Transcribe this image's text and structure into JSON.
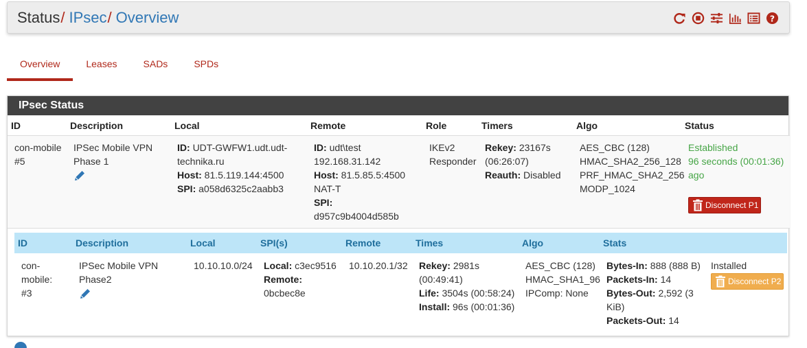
{
  "breadcrumb": {
    "root": "Status",
    "link1": "IPsec",
    "link2": "Overview",
    "sep": "/"
  },
  "header_icons": [
    "refresh-icon",
    "stop-icon",
    "sliders-icon",
    "bar-chart-icon",
    "log-icon",
    "help-icon"
  ],
  "tabs": [
    {
      "label": "Overview",
      "active": true
    },
    {
      "label": "Leases",
      "active": false
    },
    {
      "label": "SADs",
      "active": false
    },
    {
      "label": "SPDs",
      "active": false
    }
  ],
  "panel": {
    "title": "IPsec Status",
    "columns": [
      "ID",
      "Description",
      "Local",
      "Remote",
      "Role",
      "Timers",
      "Algo",
      "Status"
    ],
    "p1": {
      "id": "con-mobile #5",
      "description": "IPSec Mobile VPN Phase 1",
      "local": {
        "id_label": "ID:",
        "id_value": "UDT-GWFW1.udt.udt-technika.ru",
        "host_label": "Host:",
        "host_value": "81.5.119.144:4500",
        "spi_label": "SPI:",
        "spi_value": "a058d6325c2aabb3"
      },
      "remote": {
        "id_label": "ID:",
        "id_value": "udt\\test",
        "ip": "192.168.31.142",
        "host_label": "Host:",
        "host_value": "81.5.85.5:4500",
        "natt": "NAT-T",
        "spi_label": "SPI:",
        "spi_value": "d957c9b4004d585b"
      },
      "role": "IKEv2 Responder",
      "timers": {
        "rekey_label": "Rekey:",
        "rekey_value": "23167s",
        "rekey_paren": "(06:26:07)",
        "reauth_label": "Reauth:",
        "reauth_value": "Disabled"
      },
      "algo": [
        "AES_CBC (128)",
        "HMAC_SHA2_256_128",
        "PRF_HMAC_SHA2_256",
        "MODP_1024"
      ],
      "status": "Established",
      "status_time": "96 seconds (00:01:36) ago",
      "disconnect_label": "Disconnect P1"
    },
    "p2_columns": [
      "ID",
      "Description",
      "Local",
      "SPI(s)",
      "Remote",
      "Times",
      "Algo",
      "Stats"
    ],
    "p2": {
      "id": "con-mobile: #3",
      "description": "IPSec Mobile VPN Phase2",
      "local": "10.10.10.0/24",
      "spi": {
        "local_label": "Local:",
        "local_value": "c3ec9516",
        "remote_label": "Remote:",
        "remote_value": "0bcbec8e"
      },
      "remote": "10.10.20.1/32",
      "times": {
        "rekey_label": "Rekey:",
        "rekey_value": "2981s",
        "rekey_paren": "(00:49:41)",
        "life_label": "Life:",
        "life_value": "3504s (00:58:24)",
        "install_label": "Install:",
        "install_value": "96s (00:01:36)"
      },
      "algo": [
        "AES_CBC (128)",
        "HMAC_SHA1_96",
        "IPComp: None"
      ],
      "stats": {
        "bytes_in_label": "Bytes-In:",
        "bytes_in_value": "888 (888 B)",
        "packets_in_label": "Packets-In:",
        "packets_in_value": "14",
        "bytes_out_label": "Bytes-Out:",
        "bytes_out_value": "2,592 (3 KiB)",
        "packets_out_label": "Packets-Out:",
        "packets_out_value": "14"
      },
      "state": "Installed",
      "disconnect_label": "Disconnect P2"
    }
  },
  "colors": {
    "brand_red": "#b0281a",
    "link_blue": "#3077b5",
    "established_green": "#46a546",
    "subhead_bg": "#bde5f8"
  }
}
